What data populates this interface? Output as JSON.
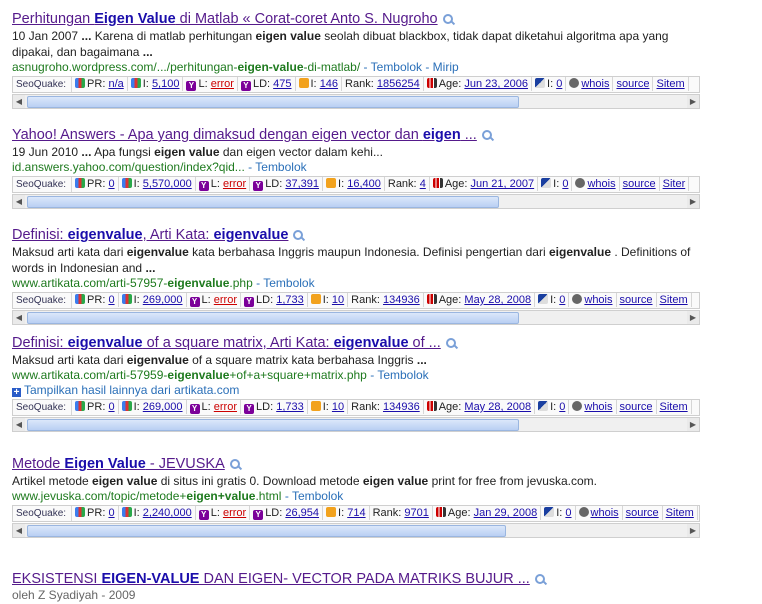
{
  "results": [
    {
      "title": [
        {
          "t": "Perhitungan ",
          "b": false
        },
        {
          "t": "Eigen Value",
          "b": true
        },
        {
          "t": " di Matlab « Corat-coret Anto S. Nugroho",
          "b": false
        }
      ],
      "snippet": [
        {
          "t": "10 Jan 2007 ",
          "b": false
        },
        {
          "t": "...",
          "b": true
        },
        {
          "t": " Karena di matlab perhitungan ",
          "b": false
        },
        {
          "t": "eigen value",
          "b": true
        },
        {
          "t": " seolah dibuat blackbox, tidak dapat diketahui algoritma apa yang dipakai, dan bagaimana ",
          "b": false
        },
        {
          "t": "...",
          "b": true
        }
      ],
      "url": [
        {
          "t": "asnugroho.wordpress.com/.../perhitungan-",
          "b": false
        },
        {
          "t": "eigen-value",
          "b": true
        },
        {
          "t": "-di-matlab/",
          "b": false
        }
      ],
      "links": [
        " - ",
        "Tembolok",
        " - ",
        "Mirip"
      ],
      "seo": {
        "pr": "n/a",
        "gi": "5,100",
        "yl": "error",
        "yld": "475",
        "bi": "146",
        "rank": "1856254",
        "age": "Jun 23, 2006",
        "di": "0",
        "whois": "whois",
        "source": "source",
        "extra": "Sitem"
      }
    },
    {
      "title": [
        {
          "t": "Yahoo! Answers - Apa yang dimaksud dengan eigen vector dan ",
          "b": false
        },
        {
          "t": "eigen",
          "b": true
        },
        {
          "t": " ...",
          "b": false
        }
      ],
      "snippet": [
        {
          "t": "19 Jun 2010 ",
          "b": false
        },
        {
          "t": "...",
          "b": true
        },
        {
          "t": " Apa fungsi ",
          "b": false
        },
        {
          "t": "eigen value",
          "b": true
        },
        {
          "t": " dan eigen vector dalam kehi...",
          "b": false
        }
      ],
      "url": [
        {
          "t": "id.answers.yahoo.com/question/index?qid...",
          "b": false
        }
      ],
      "links": [
        " - ",
        "Tembolok"
      ],
      "seo": {
        "pr": "0",
        "gi": "5,570,000",
        "yl": "error",
        "yld": "37,391",
        "bi": "16,400",
        "rank": "4",
        "age": "Jun 21, 2007",
        "di": "0",
        "whois": "whois",
        "source": "source",
        "extra": "Siter"
      }
    },
    {
      "title": [
        {
          "t": "Definisi: ",
          "b": false
        },
        {
          "t": "eigenvalue",
          "b": true
        },
        {
          "t": ", Arti Kata: ",
          "b": false
        },
        {
          "t": "eigenvalue",
          "b": true
        }
      ],
      "snippet": [
        {
          "t": "Maksud arti kata dari ",
          "b": false
        },
        {
          "t": "eigenvalue",
          "b": true
        },
        {
          "t": " kata berbahasa Inggris maupun Indonesia. Definisi pengertian dari ",
          "b": false
        },
        {
          "t": "eigenvalue",
          "b": true
        },
        {
          "t": " . Definitions of words in Indonesian and ",
          "b": false
        },
        {
          "t": "...",
          "b": true
        }
      ],
      "url": [
        {
          "t": "www.artikata.com/arti-57957-",
          "b": false
        },
        {
          "t": "eigenvalue",
          "b": true
        },
        {
          "t": ".php",
          "b": false
        }
      ],
      "links": [
        " - ",
        "Tembolok"
      ],
      "seo": {
        "pr": "0",
        "gi": "269,000",
        "yl": "error",
        "yld": "1,733",
        "bi": "10",
        "rank": "134936",
        "age": "May 28, 2008",
        "di": "0",
        "whois": "whois",
        "source": "source",
        "extra": "Sitem"
      }
    },
    {
      "title": [
        {
          "t": "Definisi: ",
          "b": false
        },
        {
          "t": "eigenvalue",
          "b": true
        },
        {
          "t": " of a square matrix, Arti Kata: ",
          "b": false
        },
        {
          "t": "eigenvalue",
          "b": true
        },
        {
          "t": " of ...",
          "b": false
        }
      ],
      "snippet": [
        {
          "t": "Maksud arti kata dari ",
          "b": false
        },
        {
          "t": "eigenvalue",
          "b": true
        },
        {
          "t": " of a square matrix kata berbahasa Inggris ",
          "b": false
        },
        {
          "t": "...",
          "b": true
        }
      ],
      "url": [
        {
          "t": "www.artikata.com/arti-57959-",
          "b": false
        },
        {
          "t": "eigenvalue",
          "b": true
        },
        {
          "t": "+of+a+square+matrix.php",
          "b": false
        }
      ],
      "links": [
        " - ",
        "Tembolok"
      ],
      "more": "Tampilkan hasil lainnya dari artikata.com",
      "seo": {
        "pr": "0",
        "gi": "269,000",
        "yl": "error",
        "yld": "1,733",
        "bi": "10",
        "rank": "134936",
        "age": "May 28, 2008",
        "di": "0",
        "whois": "whois",
        "source": "source",
        "extra": "Sitem"
      }
    },
    {
      "title": [
        {
          "t": "Metode ",
          "b": false
        },
        {
          "t": "Eigen Value",
          "b": true
        },
        {
          "t": " - JEVUSKA",
          "b": false
        }
      ],
      "snippet": [
        {
          "t": "Artikel metode ",
          "b": false
        },
        {
          "t": "eigen value",
          "b": true
        },
        {
          "t": " di situs ini gratis 0. Download metode ",
          "b": false
        },
        {
          "t": "eigen value",
          "b": true
        },
        {
          "t": " print for free from jevuska.com.",
          "b": false
        }
      ],
      "url": [
        {
          "t": "www.jevuska.com/topic/metode+",
          "b": false
        },
        {
          "t": "eigen+value",
          "b": true
        },
        {
          "t": ".html",
          "b": false
        }
      ],
      "links": [
        " - ",
        "Tembolok"
      ],
      "seo": {
        "pr": "0",
        "gi": "2,240,000",
        "yl": "error",
        "yld": "26,954",
        "bi": "714",
        "rank": "9701",
        "age": "Jan 29, 2008",
        "di": "0",
        "whois": "whois",
        "source": "source",
        "extra": "Sitem"
      }
    },
    {
      "title": [
        {
          "t": "EKSISTENSI ",
          "b": false
        },
        {
          "t": "EIGEN-VALUE",
          "b": true
        },
        {
          "t": " DAN EIGEN- VECTOR PADA MATRIKS BUJUR ...",
          "b": false
        }
      ],
      "author": "oleh Z Syadiyah - 2009"
    }
  ],
  "seo_labels": {
    "brand": "SeoQuake:",
    "pr": "PR:",
    "gi": "I:",
    "yl": "L:",
    "yld": "LD:",
    "bi": "I:",
    "rank": "Rank:",
    "age": "Age:",
    "di": "I:"
  }
}
